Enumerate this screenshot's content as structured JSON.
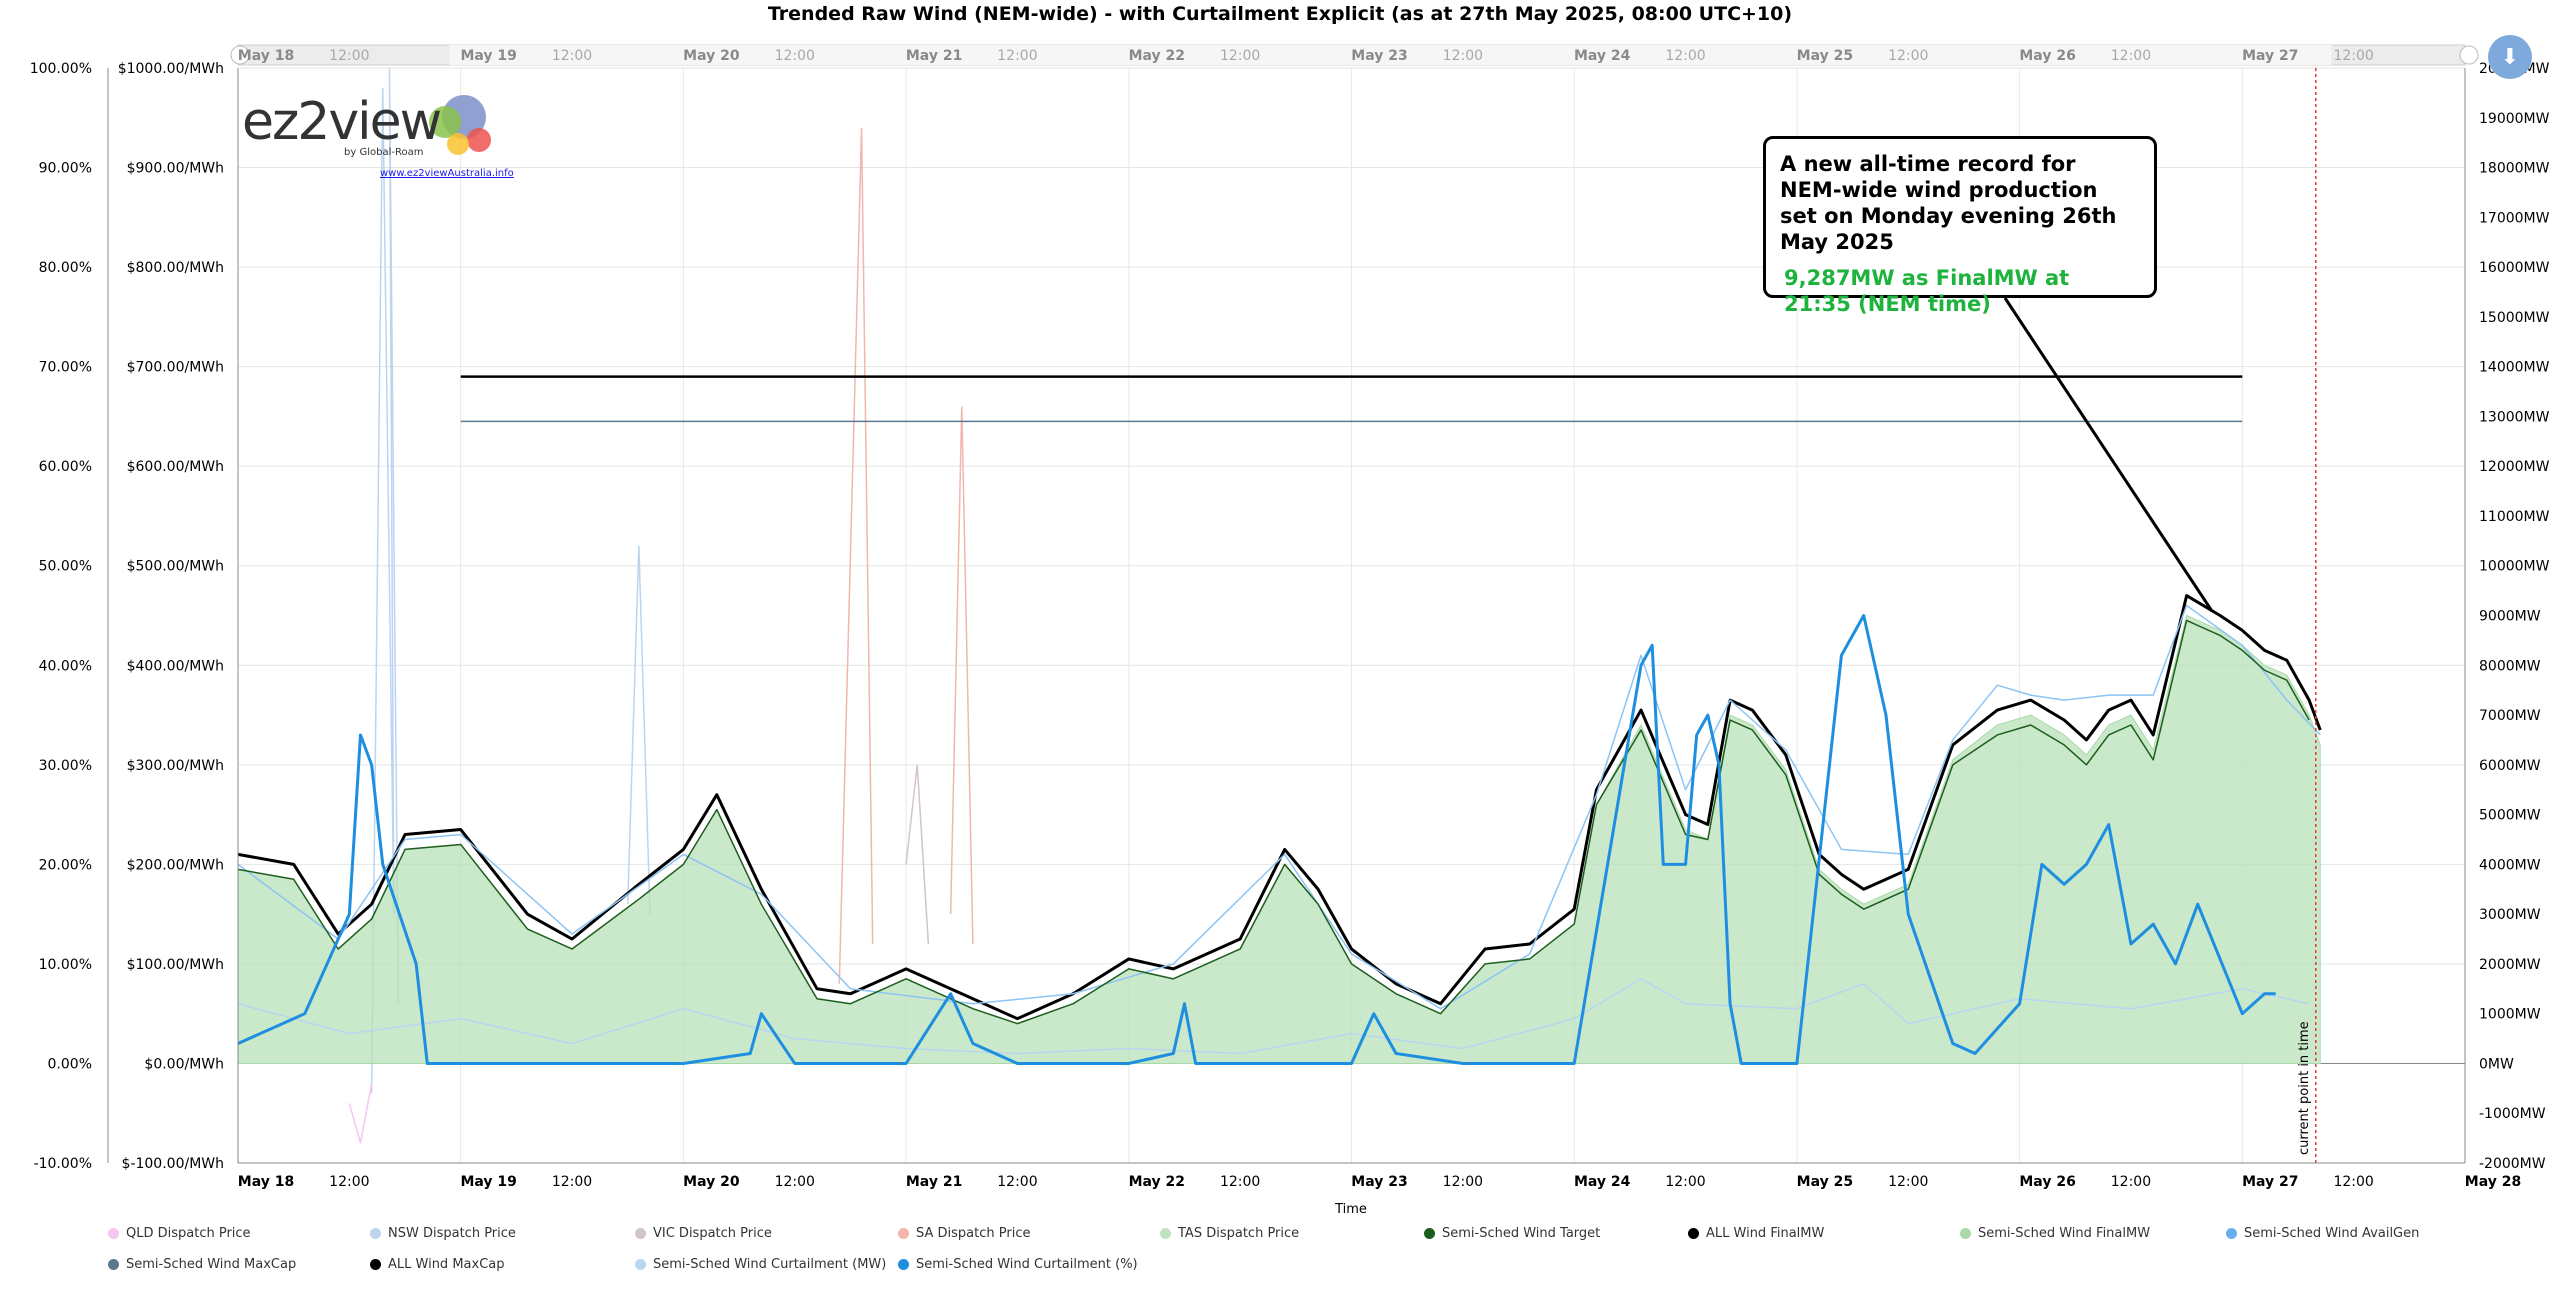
{
  "chart_data": {
    "type": "line",
    "title": "Trended Raw Wind (NEM-wide) - with Curtailment Explicit (as at 27th May 2025, 08:00 UTC+10)",
    "xlabel": "Time",
    "x_ticks": [
      "May 18",
      "12:00",
      "May 19",
      "12:00",
      "May 20",
      "12:00",
      "May 21",
      "12:00",
      "May 22",
      "12:00",
      "May 23",
      "12:00",
      "May 24",
      "12:00",
      "May 25",
      "12:00",
      "May 26",
      "12:00",
      "May 27",
      "12:00",
      "May 28"
    ],
    "x_range_days": [
      0,
      10
    ],
    "y_left_pct": {
      "ticks": [
        "-10.00%",
        "0.00%",
        "10.00%",
        "20.00%",
        "30.00%",
        "40.00%",
        "50.00%",
        "60.00%",
        "70.00%",
        "80.00%",
        "90.00%",
        "100.00%"
      ],
      "range": [
        -10,
        100
      ]
    },
    "y_left_price": {
      "ticks": [
        "$-100.00/MWh",
        "$0.00/MWh",
        "$100.00/MWh",
        "$200.00/MWh",
        "$300.00/MWh",
        "$400.00/MWh",
        "$500.00/MWh",
        "$600.00/MWh",
        "$700.00/MWh",
        "$800.00/MWh",
        "$900.00/MWh",
        "$1000.00/MWh"
      ],
      "range": [
        -100,
        1000
      ]
    },
    "y_right_mw": {
      "ticks": [
        "-2000MW",
        "-1000MW",
        "0MW",
        "1000MW",
        "2000MW",
        "3000MW",
        "4000MW",
        "5000MW",
        "6000MW",
        "7000MW",
        "8000MW",
        "9000MW",
        "10000MW",
        "11000MW",
        "12000MW",
        "13000MW",
        "14000MW",
        "15000MW",
        "16000MW",
        "17000MW",
        "18000MW",
        "19000MW",
        "20000MW"
      ],
      "range": [
        -2000,
        20000
      ]
    },
    "current_time_label": "current point in time",
    "current_time_day": 9.33,
    "series_mw": [
      {
        "name": "ALL Wind MaxCap",
        "color": "#000000",
        "x": [
          1.0,
          9.0
        ],
        "y": [
          13800,
          13800
        ]
      },
      {
        "name": "Semi-Sched Wind MaxCap",
        "color": "#5a7a8c",
        "x": [
          1.0,
          9.0
        ],
        "y": [
          12900,
          12900
        ]
      },
      {
        "name": "ALL Wind FinalMW",
        "color": "#000000",
        "x": [
          0,
          0.25,
          0.45,
          0.6,
          0.75,
          1.0,
          1.3,
          1.5,
          1.8,
          2.0,
          2.15,
          2.35,
          2.6,
          2.75,
          3.0,
          3.3,
          3.5,
          3.75,
          4.0,
          4.2,
          4.5,
          4.7,
          4.85,
          5.0,
          5.2,
          5.4,
          5.6,
          5.8,
          6.0,
          6.1,
          6.3,
          6.5,
          6.6,
          6.7,
          6.8,
          6.95,
          7.1,
          7.2,
          7.3,
          7.5,
          7.7,
          7.9,
          8.05,
          8.2,
          8.3,
          8.4,
          8.5,
          8.6,
          8.75,
          8.9,
          9.0,
          9.1,
          9.2,
          9.3,
          9.35
        ],
        "y": [
          4200,
          4000,
          2600,
          3200,
          4600,
          4700,
          3000,
          2500,
          3600,
          4300,
          5400,
          3500,
          1500,
          1400,
          1900,
          1300,
          900,
          1400,
          2100,
          1900,
          2500,
          4300,
          3500,
          2300,
          1600,
          1200,
          2300,
          2400,
          3100,
          5500,
          7100,
          5000,
          4800,
          7300,
          7100,
          6200,
          4200,
          3800,
          3500,
          3900,
          6400,
          7100,
          7300,
          6900,
          6500,
          7100,
          7300,
          6600,
          9400,
          9000,
          8700,
          8300,
          8100,
          7300,
          6700
        ]
      },
      {
        "name": "Semi-Sched Wind FinalMW",
        "color": "#a9d9a9",
        "x": [
          0,
          0.25,
          0.45,
          0.6,
          0.75,
          1.0,
          1.3,
          1.5,
          1.8,
          2.0,
          2.15,
          2.35,
          2.6,
          2.75,
          3.0,
          3.3,
          3.5,
          3.75,
          4.0,
          4.2,
          4.5,
          4.7,
          4.85,
          5.0,
          5.2,
          5.4,
          5.6,
          5.8,
          6.0,
          6.1,
          6.3,
          6.5,
          6.6,
          6.7,
          6.8,
          6.95,
          7.1,
          7.2,
          7.3,
          7.5,
          7.7,
          7.9,
          8.05,
          8.2,
          8.3,
          8.4,
          8.5,
          8.6,
          8.75,
          8.9,
          9.0,
          9.1,
          9.2,
          9.3,
          9.35
        ],
        "y": [
          3900,
          3700,
          2300,
          2900,
          4300,
          4400,
          2700,
          2300,
          3300,
          4000,
          5100,
          3200,
          1300,
          1200,
          1700,
          1100,
          800,
          1200,
          1900,
          1700,
          2300,
          4000,
          3200,
          2000,
          1400,
          1000,
          2000,
          2100,
          2800,
          5200,
          6800,
          4700,
          4500,
          7000,
          6800,
          5900,
          3900,
          3500,
          3200,
          3600,
          6100,
          6800,
          7000,
          6600,
          6200,
          6800,
          7000,
          6300,
          9000,
          8700,
          8400,
          8000,
          7800,
          7000,
          6400
        ]
      },
      {
        "name": "Semi-Sched Wind AvailGen",
        "color": "#8cc4f5",
        "x": [
          0,
          0.45,
          0.75,
          1.0,
          1.5,
          2.0,
          2.35,
          2.75,
          3.3,
          3.75,
          4.2,
          4.7,
          5.0,
          5.4,
          5.8,
          6.1,
          6.3,
          6.5,
          6.7,
          6.95,
          7.2,
          7.5,
          7.7,
          7.9,
          8.05,
          8.2,
          8.4,
          8.6,
          8.75,
          9.0,
          9.2,
          9.35
        ],
        "y": [
          4000,
          2500,
          4500,
          4600,
          2600,
          4200,
          3400,
          1500,
          1200,
          1400,
          2000,
          4200,
          2200,
          1100,
          2200,
          5400,
          8200,
          5500,
          7300,
          6300,
          4300,
          4200,
          6500,
          7600,
          7400,
          7300,
          7400,
          7400,
          9200,
          8400,
          7300,
          6600
        ]
      },
      {
        "name": "Semi-Sched Wind Target",
        "color": "#1d5e1d",
        "x": [
          0,
          0.25,
          0.45,
          0.6,
          0.75,
          1.0,
          1.3,
          1.5,
          1.8,
          2.0,
          2.15,
          2.35,
          2.6,
          2.75,
          3.0,
          3.3,
          3.5,
          3.75,
          4.0,
          4.2,
          4.5,
          4.7,
          4.85,
          5.0,
          5.2,
          5.4,
          5.6,
          5.8,
          6.0,
          6.1,
          6.3,
          6.5,
          6.6,
          6.7,
          6.8,
          6.95,
          7.1,
          7.2,
          7.3,
          7.5,
          7.7,
          7.9,
          8.05,
          8.2,
          8.3,
          8.4,
          8.5,
          8.6,
          8.75,
          8.9,
          9.0,
          9.1,
          9.2,
          9.3
        ],
        "y": [
          3900,
          3700,
          2300,
          2900,
          4300,
          4400,
          2700,
          2300,
          3300,
          4000,
          5100,
          3200,
          1300,
          1200,
          1700,
          1100,
          800,
          1200,
          1900,
          1700,
          2300,
          4000,
          3200,
          2000,
          1400,
          1000,
          2000,
          2100,
          2800,
          5200,
          6700,
          4600,
          4500,
          6900,
          6700,
          5800,
          3800,
          3400,
          3100,
          3500,
          6000,
          6600,
          6800,
          6400,
          6000,
          6600,
          6800,
          6100,
          8900,
          8600,
          8300,
          7900,
          7700,
          6900
        ]
      },
      {
        "name": "Semi-Sched Wind Curtailment (MW)",
        "color": "#b8d6f2",
        "x": [
          0,
          0.5,
          1.0,
          1.5,
          2.0,
          2.5,
          3.0,
          3.5,
          4.0,
          4.5,
          5.0,
          5.5,
          6.0,
          6.3,
          6.5,
          7.0,
          7.3,
          7.5,
          8.0,
          8.5,
          9.0,
          9.3
        ],
        "y": [
          1200,
          600,
          900,
          400,
          1100,
          500,
          300,
          200,
          300,
          200,
          600,
          300,
          900,
          1700,
          1200,
          1100,
          1600,
          800,
          1300,
          1100,
          1500,
          1200
        ]
      }
    ],
    "series_pct": [
      {
        "name": "Semi-Sched Wind Curtailment (%)",
        "color": "#1e8fe0",
        "x": [
          0,
          0.3,
          0.5,
          0.55,
          0.6,
          0.65,
          0.8,
          0.85,
          1.0,
          1.5,
          2.0,
          2.3,
          2.35,
          2.5,
          3.0,
          3.2,
          3.3,
          3.5,
          4.0,
          4.2,
          4.25,
          4.3,
          4.5,
          5.0,
          5.1,
          5.2,
          5.5,
          6.0,
          6.3,
          6.35,
          6.4,
          6.5,
          6.55,
          6.6,
          6.65,
          6.7,
          6.75,
          7.0,
          7.2,
          7.3,
          7.4,
          7.5,
          7.7,
          7.8,
          8.0,
          8.1,
          8.2,
          8.3,
          8.4,
          8.5,
          8.6,
          8.7,
          8.8,
          9.0,
          9.1,
          9.15
        ],
        "y": [
          2,
          5,
          15,
          33,
          30,
          20,
          10,
          0,
          0,
          0,
          0,
          1,
          5,
          0,
          0,
          7,
          2,
          0,
          0,
          1,
          6,
          0,
          0,
          0,
          5,
          1,
          0,
          0,
          40,
          42,
          20,
          20,
          33,
          35,
          30,
          6,
          0,
          0,
          41,
          45,
          35,
          15,
          2,
          1,
          6,
          20,
          18,
          20,
          24,
          12,
          14,
          10,
          16,
          5,
          7,
          7
        ]
      }
    ],
    "series_price": [
      {
        "name": "QLD Dispatch Price",
        "color": "#f5c6ef"
      },
      {
        "name": "NSW Dispatch Price",
        "color": "#bcd4f0"
      },
      {
        "name": "VIC Dispatch Price",
        "color": "#d3c3cf"
      },
      {
        "name": "SA Dispatch Price",
        "color": "#f2b6ae"
      },
      {
        "name": "TAS Dispatch Price",
        "color": "#bfe3bf"
      }
    ],
    "legend": [
      {
        "name": "QLD Dispatch Price",
        "color": "#f5c6ef"
      },
      {
        "name": "NSW Dispatch Price",
        "color": "#bcd4f0"
      },
      {
        "name": "VIC Dispatch Price",
        "color": "#d3c3cf"
      },
      {
        "name": "SA Dispatch Price",
        "color": "#f2b6ae"
      },
      {
        "name": "TAS Dispatch Price",
        "color": "#bfe3bf"
      },
      {
        "name": "Semi-Sched Wind Target",
        "color": "#1d5e1d"
      },
      {
        "name": "ALL Wind FinalMW",
        "color": "#000000"
      },
      {
        "name": "Semi-Sched Wind FinalMW",
        "color": "#a9d9a9"
      },
      {
        "name": "Semi-Sched Wind AvailGen",
        "color": "#6aaef0"
      },
      {
        "name": "Semi-Sched Wind MaxCap",
        "color": "#5a7a8c"
      },
      {
        "name": "ALL Wind MaxCap",
        "color": "#000000"
      },
      {
        "name": "Semi-Sched Wind Curtailment (MW)",
        "color": "#b8d6f2"
      },
      {
        "name": "Semi-Sched Wind Curtailment (%)",
        "color": "#1e8fe0"
      }
    ],
    "grid": true,
    "legend_position": "bottom"
  },
  "annotation": {
    "main": "A new all-time record for NEM-wide wind production set on Monday evening 26th May 2025",
    "sub": "9,287MW as FinalMW at 21:35 (NEM time)"
  },
  "logo": {
    "word": "ez2view",
    "byline": "by Global-Roam",
    "url": "www.ez2viewAustralia.info"
  }
}
